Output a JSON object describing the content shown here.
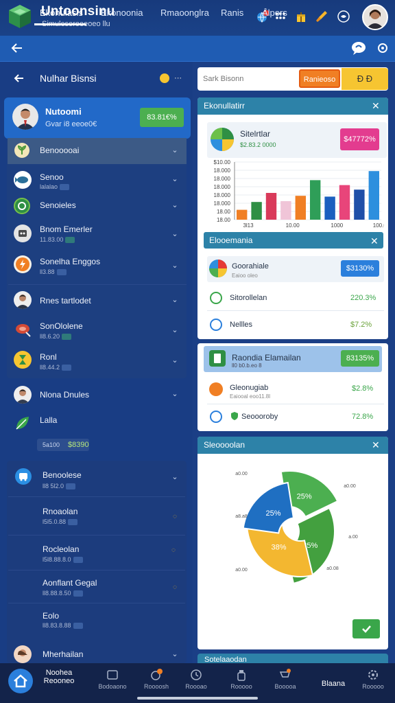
{
  "header": {
    "title": "Untoonsinu",
    "subtitle": "Simulesoroeeoeo llu",
    "notification_count": "2",
    "icons": [
      "world-notification-icon",
      "grid-icon",
      "gift-icon",
      "brush-icon",
      "globe-icon"
    ]
  },
  "tabs": [
    {
      "label": "Ekonulasis",
      "active": true
    },
    {
      "label": "Ekonoonia",
      "active": false
    },
    {
      "label": "Rmaoonglra",
      "active": false
    },
    {
      "label": "Ranis",
      "active": false
    },
    {
      "label": "Alpors",
      "active": false
    }
  ],
  "left": {
    "header_title": "Nulhar Bisnsi",
    "profile": {
      "name": "Nutoomi",
      "sub": "Gvar i8 eeoe0€",
      "badge": "83.81€%"
    },
    "section_title": "Benooooai",
    "rows": [
      {
        "label": "Senoo",
        "sub": "lalalao"
      },
      {
        "label": "Senoieles",
        "sub": ""
      },
      {
        "label": "Bnom Emerler",
        "sub": "11.83.00"
      },
      {
        "label": "Sonelha Enggos",
        "sub": "ll3.88"
      },
      {
        "label": "Rnes tartlodet",
        "sub": ""
      },
      {
        "label": "SonOlolene",
        "sub": "ll8.6.20"
      },
      {
        "label": "Ronl",
        "sub": "ll8.44.2"
      }
    ],
    "extra_rows": [
      {
        "label": "Nlona Dnules"
      },
      {
        "label": "Lalla"
      }
    ],
    "amount": {
      "left": "5a100",
      "right": "$8390"
    },
    "lower": {
      "title": "Benoolese",
      "title_sub": "ll8 5l2.0",
      "rows": [
        {
          "label": "Rnoaolan",
          "sub": "l5l5.0.88"
        },
        {
          "label": "Rocleolan",
          "sub": "l5l8.88.8.0"
        },
        {
          "label": "Aonflant Gegal",
          "sub": "ll8.88.8.50"
        },
        {
          "label": "Eolo",
          "sub": "ll8.83.8.88"
        }
      ],
      "footer_label": "Mherhailan"
    }
  },
  "search": {
    "placeholder": "Sark Bisonn",
    "button": "Ranieoso",
    "icons": "Ð Ð"
  },
  "card1": {
    "title": "Ekonullatirr",
    "legend_title": "Sitelrtlar",
    "legend_sub": "$2.83.2 0000",
    "badge": "$47772%"
  },
  "chart_data": {
    "type": "bar",
    "yticks": [
      "$10.00",
      "18.000",
      "18.000",
      "18.000",
      "18.000",
      "18.000",
      "18.00",
      "18.00"
    ],
    "xticks": [
      "3l13",
      "10.00",
      "1000",
      "100.00"
    ],
    "values": [
      2.4,
      4.3,
      6.5,
      4.5,
      5.8,
      9.6,
      5.6,
      8.4,
      7.3,
      11.8
    ],
    "colors": [
      "#f07f24",
      "#2f8f44",
      "#d93a5a",
      "#f0c5d8",
      "#f07f24",
      "#2f9e58",
      "#1b5fbf",
      "#e8457a",
      "#1f4fa8",
      "#2d8fde"
    ],
    "ylim": [
      0,
      14
    ]
  },
  "card2": {
    "title": "Elooemania",
    "rows": [
      {
        "label": "Goorahiale",
        "sub": "Eaioo oleo",
        "value": "$3130%",
        "style": "pill-blue"
      },
      {
        "label": "Sitorollelan",
        "sub": "",
        "value": "220.3%",
        "style": "text-green"
      },
      {
        "label": "Nellles",
        "sub": "",
        "value": "$7.2%",
        "style": "text-green"
      }
    ]
  },
  "card3": {
    "highlight": {
      "label": "Raondia Elamailan",
      "sub": "ll0 b0.b.eo 8",
      "value": "83135%"
    },
    "rows": [
      {
        "label": "Gleonugiab",
        "sub": "Eaiooal eoo11.8l",
        "value": "$2.8%"
      },
      {
        "label": "Seoooroby",
        "sub": "",
        "value": "72.8%"
      }
    ]
  },
  "card4": {
    "title": "Sleoooolan",
    "pie": {
      "type": "pie",
      "slices": [
        {
          "value": 25,
          "label": "25%",
          "color": "#4caf50"
        },
        {
          "value": 35,
          "label": "35%",
          "color": "#43a03f"
        },
        {
          "value": 38,
          "label": "38%",
          "color": "#f3b730"
        },
        {
          "value": 25,
          "label": "25%",
          "color": "#1f6fc2"
        }
      ],
      "callouts": [
        "a0.00",
        "a0.00",
        "a8.a8",
        "a.00",
        "a0.00",
        "a0.08"
      ]
    },
    "action_icon": "check-icon"
  },
  "card5_title": "Sotelaaodan",
  "bottom_nav": [
    {
      "label": "Noohea\nReooneo",
      "icon": "home-icon"
    },
    {
      "label": "Bodoaono",
      "icon": "image-icon"
    },
    {
      "label": "Roooosh",
      "icon": "badge-icon"
    },
    {
      "label": "Roooao",
      "icon": "clock-icon"
    },
    {
      "label": "Rooooo",
      "icon": "bottle-icon"
    },
    {
      "label": "Booooa",
      "icon": "cart-icon"
    },
    {
      "label": "Blaana",
      "icon": ""
    },
    {
      "label": "Rooooo",
      "icon": "settings-icon"
    }
  ]
}
